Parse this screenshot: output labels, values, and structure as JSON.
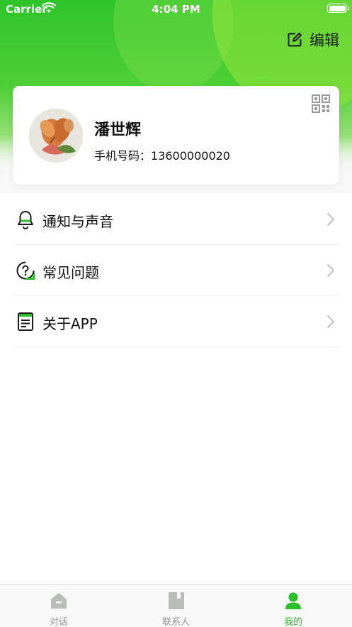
{
  "status_bar": {
    "carrier": "Carrier",
    "time": "4:04 PM"
  },
  "header": {
    "edit_label": "编辑"
  },
  "profile": {
    "name": "潘世辉",
    "phone_label": "手机号码：13600000020"
  },
  "menu": {
    "items": [
      {
        "label": "通知与声音",
        "icon": "bell-icon"
      },
      {
        "label": "常见问题",
        "icon": "question-icon"
      },
      {
        "label": "关于APP",
        "icon": "document-icon"
      }
    ]
  },
  "tab_bar": {
    "tabs": [
      {
        "label": "对话",
        "icon": "home-icon",
        "active": false
      },
      {
        "label": "联系人",
        "icon": "contacts-icon",
        "active": false
      },
      {
        "label": "我的",
        "icon": "person-icon",
        "active": true
      }
    ]
  },
  "colors": {
    "accent": "#2bbf2a",
    "header_green": "#2ec42a",
    "inactive_tab": "#999999"
  }
}
